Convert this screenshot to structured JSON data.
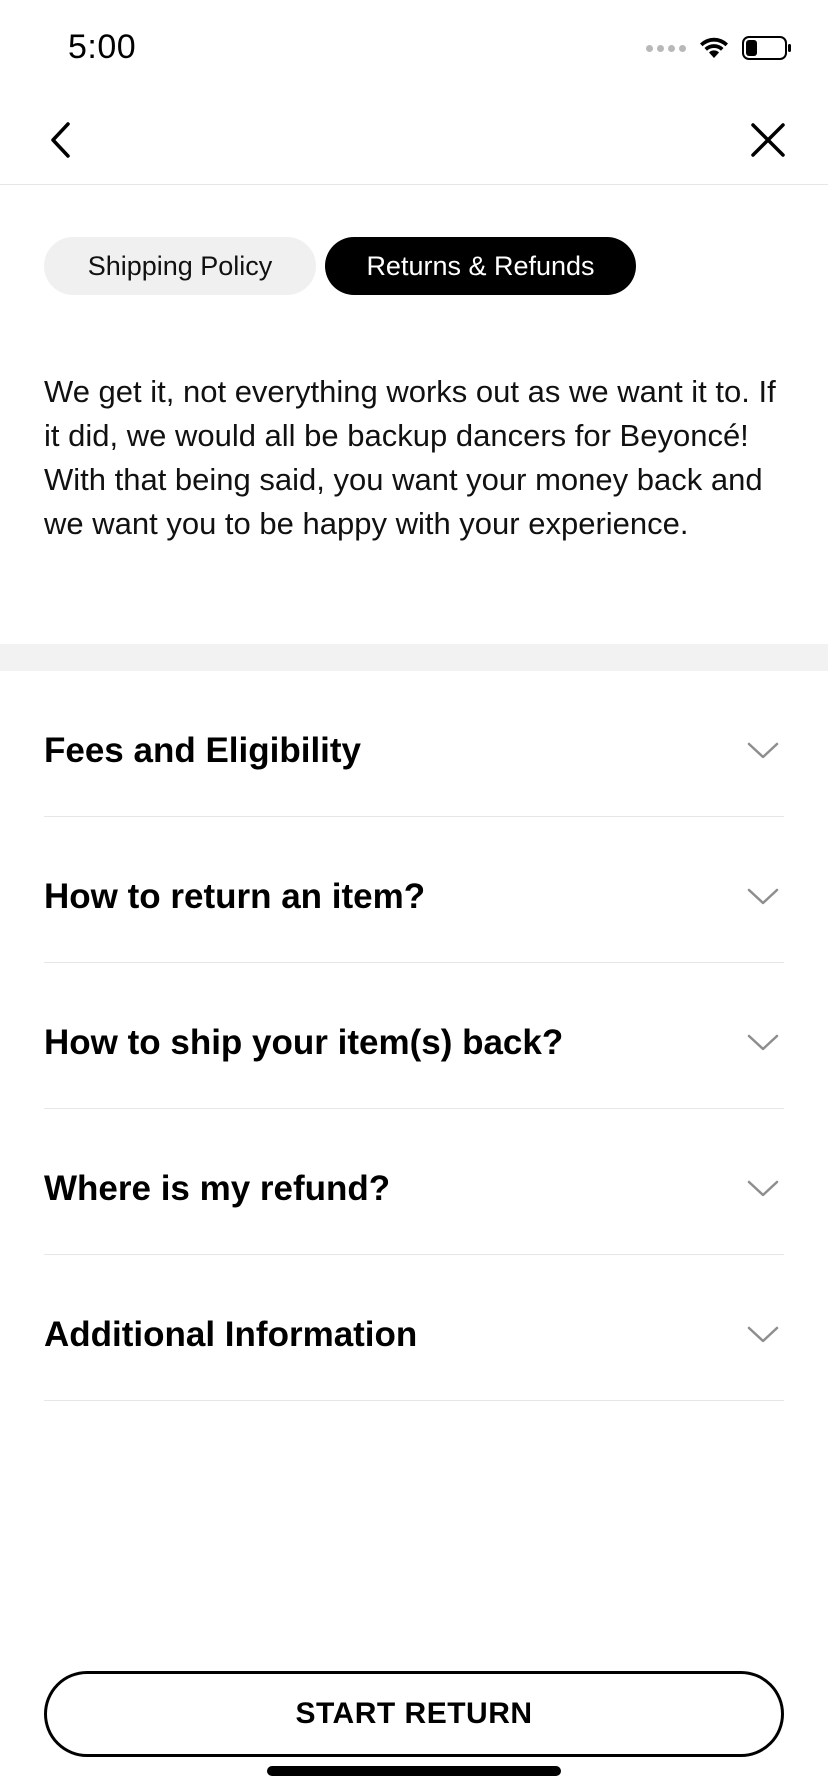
{
  "status_bar": {
    "time": "5:00"
  },
  "nav": {
    "back_icon": "chevron-left-icon",
    "close_icon": "close-icon"
  },
  "tabs": [
    {
      "label": "Shipping Policy",
      "selected": false
    },
    {
      "label": "Returns & Refunds",
      "selected": true
    }
  ],
  "intro_text": "We get it, not everything works out as we want it to. If it did, we would all be backup dancers for Beyoncé! With that being said, you want your money back and we want you to be happy with your experience.",
  "accordion": [
    {
      "title": "Fees and Eligibility"
    },
    {
      "title": "How to return an item?"
    },
    {
      "title": "How to ship your item(s) back?"
    },
    {
      "title": "Where is my refund?"
    },
    {
      "title": "Additional Information"
    }
  ],
  "primary_action": {
    "label": "START RETURN"
  },
  "colors": {
    "accent": "#000000",
    "inactive_tab": "#f0f0f0",
    "divider": "#e6e6e6",
    "chevron": "#8e8e8e"
  }
}
